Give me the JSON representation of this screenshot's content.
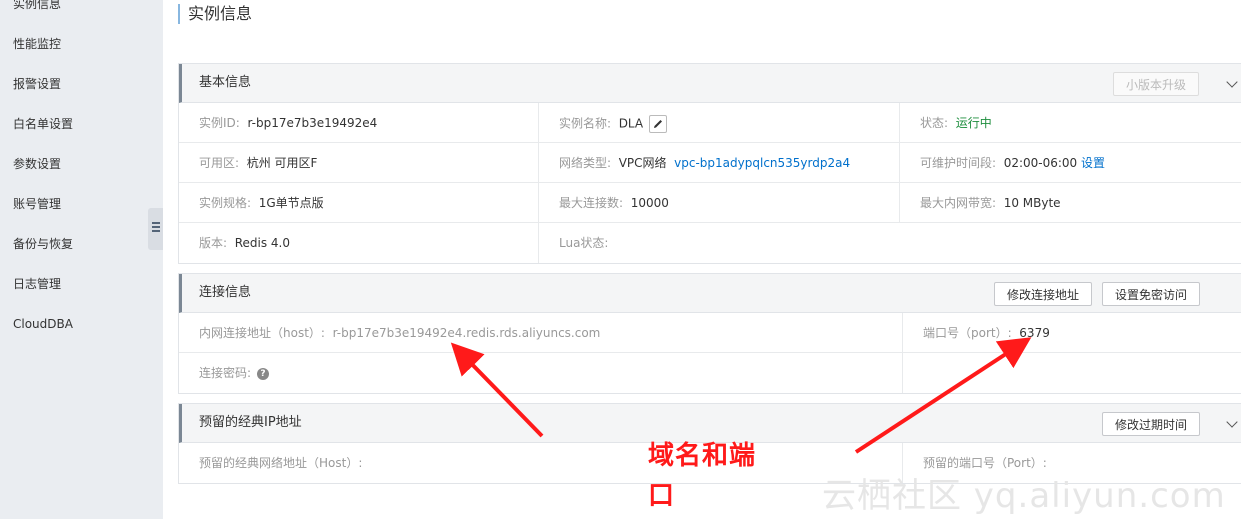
{
  "sidebar": {
    "items": [
      {
        "label": "实例信息"
      },
      {
        "label": "性能监控"
      },
      {
        "label": "报警设置"
      },
      {
        "label": "白名单设置"
      },
      {
        "label": "参数设置"
      },
      {
        "label": "账号管理"
      },
      {
        "label": "备份与恢复"
      },
      {
        "label": "日志管理"
      },
      {
        "label": "CloudDBA"
      }
    ]
  },
  "page": {
    "title": "实例信息"
  },
  "basic": {
    "title": "基本信息",
    "upgrade_button": "小版本升级",
    "instance_id_label": "实例ID:",
    "instance_id_value": "r-bp17e7b3e19492e4",
    "instance_name_label": "实例名称:",
    "instance_name_value": "DLA",
    "status_label": "状态:",
    "status_value": "运行中",
    "zone_label": "可用区:",
    "zone_value": "杭州 可用区F",
    "network_label": "网络类型:",
    "network_value": "VPC网络",
    "network_vpc": "vpc-bp1adypqlcn535yrdp2a4",
    "maint_label": "可维护时间段:",
    "maint_value": "02:00-06:00",
    "maint_link": "设置",
    "spec_label": "实例规格:",
    "spec_value": "1G单节点版",
    "maxconn_label": "最大连接数:",
    "maxconn_value": "10000",
    "bandwidth_label": "最大内网带宽:",
    "bandwidth_value": "10 MByte",
    "version_label": "版本:",
    "version_value": "Redis 4.0",
    "lua_label": "Lua状态:"
  },
  "connection": {
    "title": "连接信息",
    "modify_button": "修改连接地址",
    "nopwd_button": "设置免密访问",
    "host_label": "内网连接地址（host）:",
    "host_value": "r-bp17e7b3e19492e4.redis.rds.aliyuncs.com",
    "port_label": "端口号（port）:",
    "port_value": "6379",
    "password_label": "连接密码:"
  },
  "reserved": {
    "title": "预留的经典IP地址",
    "expire_button": "修改过期时间",
    "host_label": "预留的经典网络地址（Host）:",
    "port_label": "预留的端口号（Port）:"
  },
  "annotation": {
    "text": "域名和端口"
  },
  "watermark": {
    "text": "云栖社区 yq.aliyun.com"
  },
  "colors": {
    "annotation": "#ff1a1a",
    "link": "#0070cc",
    "running": "#1e8e3e"
  },
  "icons": [
    "edit-icon",
    "help-icon",
    "chevron-down-icon",
    "collapse-icon"
  ]
}
